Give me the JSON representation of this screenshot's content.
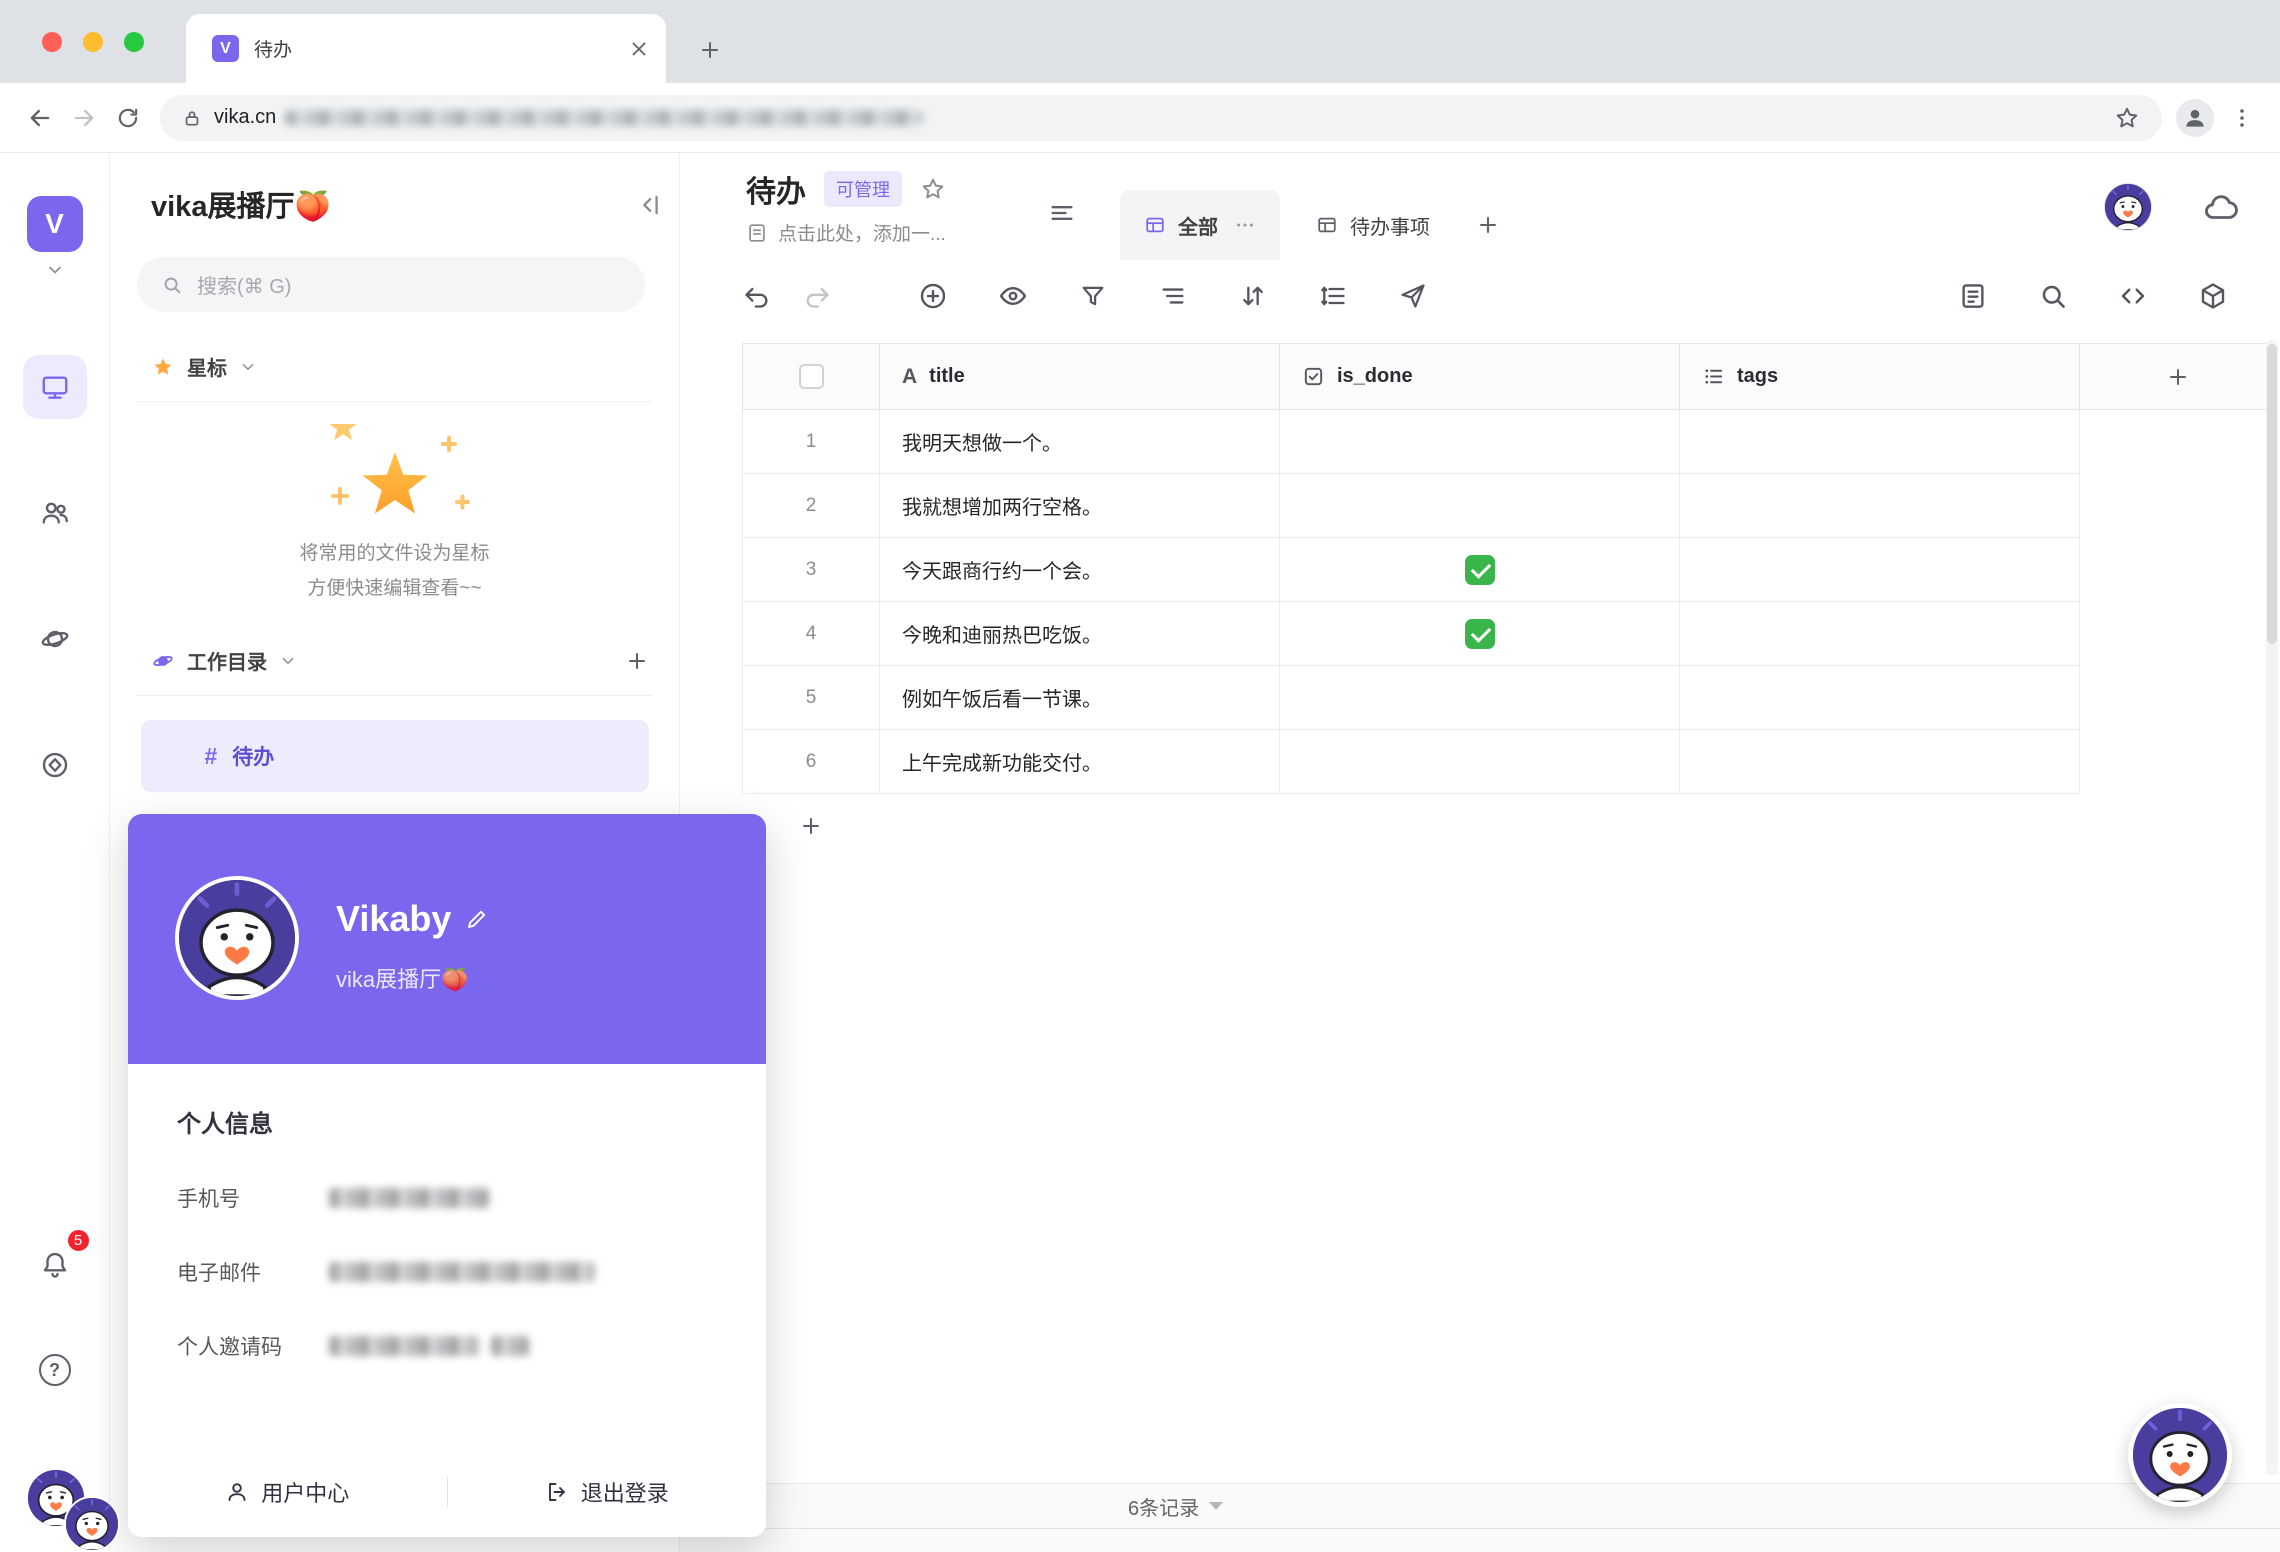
{
  "browser": {
    "tab_title": "待办",
    "url_host": "vika.cn"
  },
  "brand": {
    "glyph": "V"
  },
  "rail": {
    "notification_count": "5",
    "help_glyph": "?"
  },
  "sidebar": {
    "workspace_title": "vika展播厅🍑",
    "search_placeholder": "搜索(⌘ G)",
    "starred_label": "星标",
    "starred_hint_line1": "将常用的文件设为星标",
    "starred_hint_line2": "方便快速编辑查看~~",
    "directory_label": "工作目录",
    "active_file_glyph": "#",
    "active_file_label": "待办"
  },
  "profile_card": {
    "name": "Vikaby",
    "workspace": "vika展播厅🍑",
    "section_title": "个人信息",
    "fields": [
      {
        "label": "手机号"
      },
      {
        "label": "电子邮件"
      },
      {
        "label": "个人邀请码"
      }
    ],
    "user_center_label": "用户中心",
    "logout_label": "退出登录"
  },
  "main": {
    "title": "待办",
    "permission_badge": "可管理",
    "description_placeholder": "点击此处，添加一...",
    "views": [
      {
        "label": "全部",
        "active": true
      },
      {
        "label": "待办事项",
        "active": false
      }
    ],
    "record_count": "6条记录"
  },
  "table": {
    "columns": [
      {
        "name": "title",
        "type": "text",
        "glyph": "A"
      },
      {
        "name": "is_done",
        "type": "checkbox"
      },
      {
        "name": "tags",
        "type": "multi-select"
      }
    ],
    "rows": [
      {
        "num": "1",
        "title": "我明天想做一个。",
        "is_done": false
      },
      {
        "num": "2",
        "title": "我就想增加两行空格。",
        "is_done": false
      },
      {
        "num": "3",
        "title": "今天跟商行约一个会。",
        "is_done": true
      },
      {
        "num": "4",
        "title": "今晚和迪丽热巴吃饭。",
        "is_done": true
      },
      {
        "num": "5",
        "title": "例如午饭后看一节课。",
        "is_done": false
      },
      {
        "num": "6",
        "title": "上午完成新功能交付。",
        "is_done": false
      }
    ]
  },
  "colors": {
    "accent": "#7b67ee",
    "accent_light": "#edecfc",
    "done_green": "#3ab54b",
    "badge_red": "#f5222d"
  }
}
